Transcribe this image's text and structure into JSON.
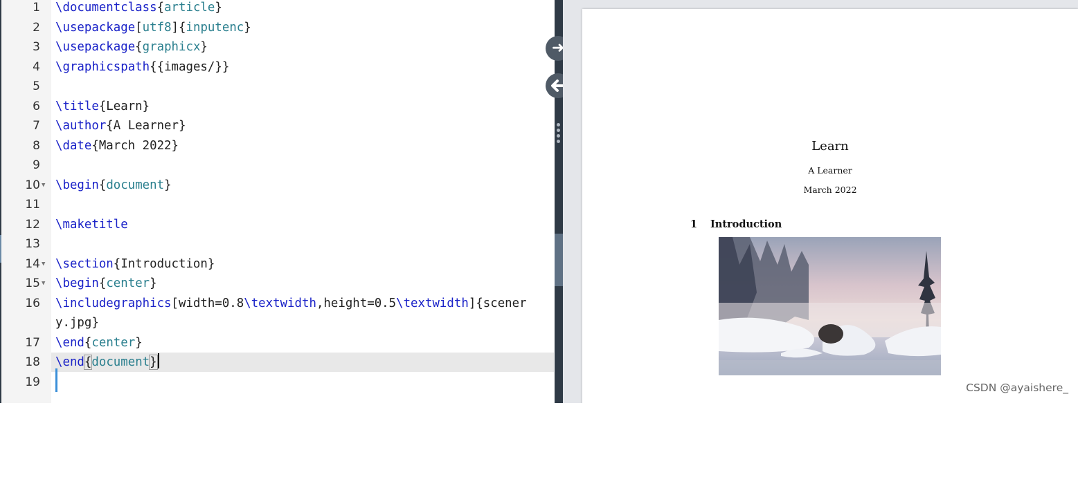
{
  "editor": {
    "lines": [
      {
        "num": "1",
        "fold": "",
        "tokens": [
          {
            "t": "\\documentclass",
            "c": "kw"
          },
          {
            "t": "{"
          },
          {
            "t": "article",
            "c": "arg"
          },
          {
            "t": "}"
          }
        ]
      },
      {
        "num": "2",
        "fold": "",
        "tokens": [
          {
            "t": "\\usepackage",
            "c": "kw"
          },
          {
            "t": "["
          },
          {
            "t": "utf8",
            "c": "arg"
          },
          {
            "t": "]{"
          },
          {
            "t": "inputenc",
            "c": "arg"
          },
          {
            "t": "}"
          }
        ]
      },
      {
        "num": "3",
        "fold": "",
        "tokens": [
          {
            "t": "\\usepackage",
            "c": "kw"
          },
          {
            "t": "{"
          },
          {
            "t": "graphicx",
            "c": "arg"
          },
          {
            "t": "}"
          }
        ]
      },
      {
        "num": "4",
        "fold": "",
        "tokens": [
          {
            "t": "\\graphicspath",
            "c": "kw"
          },
          {
            "t": "{{images/}}"
          }
        ]
      },
      {
        "num": "5",
        "fold": "",
        "tokens": []
      },
      {
        "num": "6",
        "fold": "",
        "tokens": [
          {
            "t": "\\title",
            "c": "kw"
          },
          {
            "t": "{Learn}"
          }
        ]
      },
      {
        "num": "7",
        "fold": "",
        "tokens": [
          {
            "t": "\\author",
            "c": "kw"
          },
          {
            "t": "{A Learner}"
          }
        ]
      },
      {
        "num": "8",
        "fold": "",
        "tokens": [
          {
            "t": "\\date",
            "c": "kw"
          },
          {
            "t": "{March 2022}"
          }
        ]
      },
      {
        "num": "9",
        "fold": "",
        "tokens": []
      },
      {
        "num": "10",
        "fold": "▼",
        "tokens": [
          {
            "t": "\\begin",
            "c": "kw"
          },
          {
            "t": "{"
          },
          {
            "t": "document",
            "c": "arg"
          },
          {
            "t": "}"
          }
        ]
      },
      {
        "num": "11",
        "fold": "",
        "tokens": []
      },
      {
        "num": "12",
        "fold": "",
        "tokens": [
          {
            "t": "\\maketitle",
            "c": "kw"
          }
        ]
      },
      {
        "num": "13",
        "fold": "",
        "tokens": []
      },
      {
        "num": "14",
        "fold": "▼",
        "tokens": [
          {
            "t": "\\section",
            "c": "kw"
          },
          {
            "t": "{Introduction}"
          }
        ]
      },
      {
        "num": "15",
        "fold": "▼",
        "tokens": [
          {
            "t": "\\begin",
            "c": "kw"
          },
          {
            "t": "{"
          },
          {
            "t": "center",
            "c": "arg"
          },
          {
            "t": "}"
          }
        ]
      },
      {
        "num": "16",
        "fold": "",
        "tokens": [
          {
            "t": "\\includegraphics",
            "c": "kw"
          },
          {
            "t": "[width=0.8"
          },
          {
            "t": "\\textwidth",
            "c": "kw"
          },
          {
            "t": ",height=0.5"
          },
          {
            "t": "\\textwidth",
            "c": "kw"
          },
          {
            "t": "]{scener"
          }
        ]
      },
      {
        "num": "",
        "fold": "",
        "tokens": [
          {
            "t": "y.jpg}"
          }
        ]
      },
      {
        "num": "17",
        "fold": "",
        "tokens": [
          {
            "t": "\\end",
            "c": "kw"
          },
          {
            "t": "{"
          },
          {
            "t": "center",
            "c": "arg"
          },
          {
            "t": "}"
          }
        ]
      },
      {
        "num": "18",
        "fold": "",
        "tokens": [
          {
            "t": "\\end",
            "c": "kw"
          },
          {
            "t": "{",
            "c": "bracket-hl"
          },
          {
            "t": "document",
            "c": "arg"
          },
          {
            "t": "}",
            "c": "bracket-hl"
          }
        ],
        "active": true,
        "cursor": true
      },
      {
        "num": "19",
        "fold": "",
        "tokens": []
      }
    ]
  },
  "splitter": {
    "forward_icon": "arrow-right-icon",
    "back_icon": "arrow-left-icon",
    "forward_glyph": "➜",
    "back_glyph": "🡐",
    "collapse_glyph": "›"
  },
  "preview": {
    "title": "Learn",
    "author": "A Learner",
    "date": "March 2022",
    "section_number": "1",
    "section_title": "Introduction",
    "image_name": "scenery-image"
  },
  "watermark": "CSDN @ayaishere_",
  "colors": {
    "keyword": "#1a22c8",
    "argument": "#2a7f8e",
    "splitter": "#2f3a46",
    "active_line": "#e8e8e8"
  }
}
